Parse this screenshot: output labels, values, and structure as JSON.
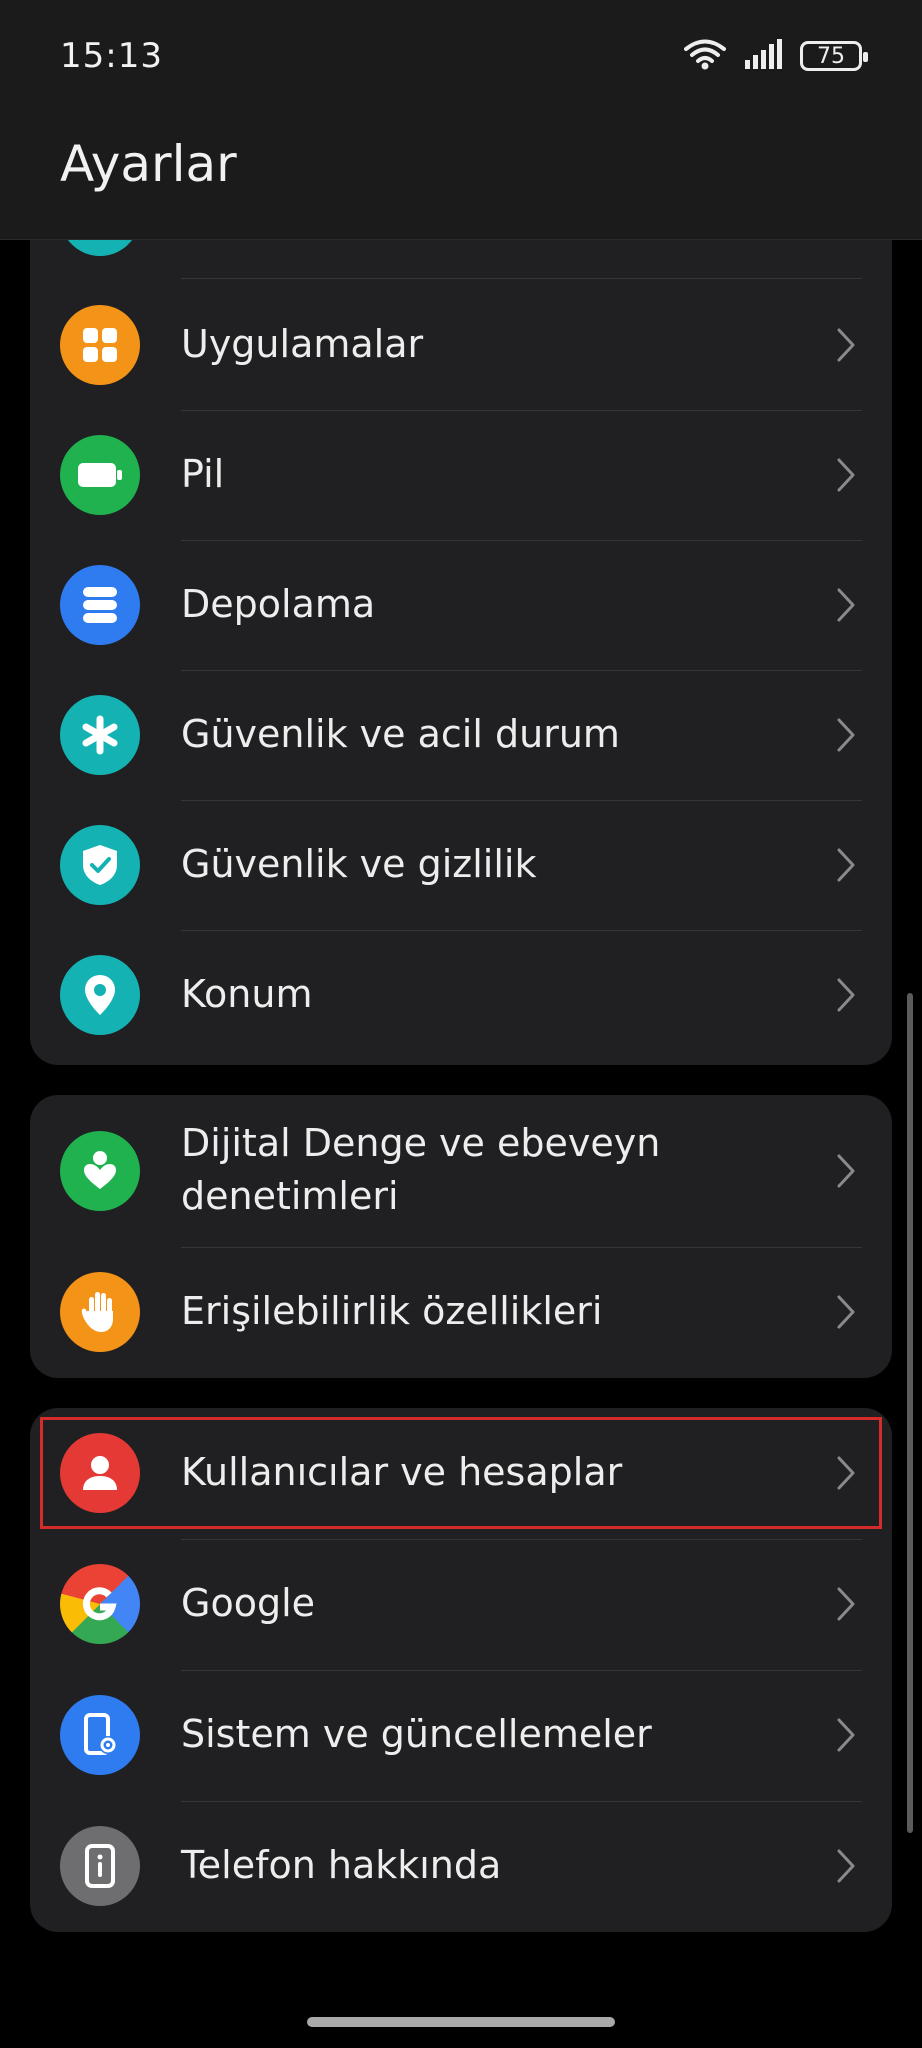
{
  "status_bar": {
    "time": "15:13",
    "battery": "75"
  },
  "header": {
    "title": "Ayarlar"
  },
  "groups": [
    {
      "items": [
        {
          "label": "Uygulamalar",
          "icon": "apps-grid-icon",
          "color": "#F39317"
        },
        {
          "label": "Pil",
          "icon": "battery-icon",
          "color": "#1FB24F"
        },
        {
          "label": "Depolama",
          "icon": "storage-icon",
          "color": "#2F7CF0"
        },
        {
          "label": "Güvenlik ve acil durum",
          "icon": "emergency-asterisk-icon",
          "color": "#15B2B4"
        },
        {
          "label": "Güvenlik ve gizlilik",
          "icon": "shield-check-icon",
          "color": "#15B2B4"
        },
        {
          "label": "Konum",
          "icon": "location-pin-icon",
          "color": "#15B2B4"
        }
      ]
    },
    {
      "items": [
        {
          "label_line1": "Dijital Denge ve ebeveyn",
          "label_line2": "denetimleri",
          "icon": "digital-balance-icon",
          "color": "#1FB24F"
        },
        {
          "label": "Erişilebilirlik özellikleri",
          "icon": "hand-icon",
          "color": "#F39317"
        }
      ]
    },
    {
      "items": [
        {
          "label": "Kullanıcılar ve hesaplar",
          "icon": "user-icon",
          "color": "#E53935"
        },
        {
          "label": "Google",
          "icon": "google-icon",
          "color": "#FFFFFF"
        },
        {
          "label": "Sistem ve güncellemeler",
          "icon": "phone-settings-icon",
          "color": "#2F7CF0"
        },
        {
          "label": "Telefon hakkında",
          "icon": "phone-info-icon",
          "color": "#6E6E70"
        }
      ]
    }
  ]
}
